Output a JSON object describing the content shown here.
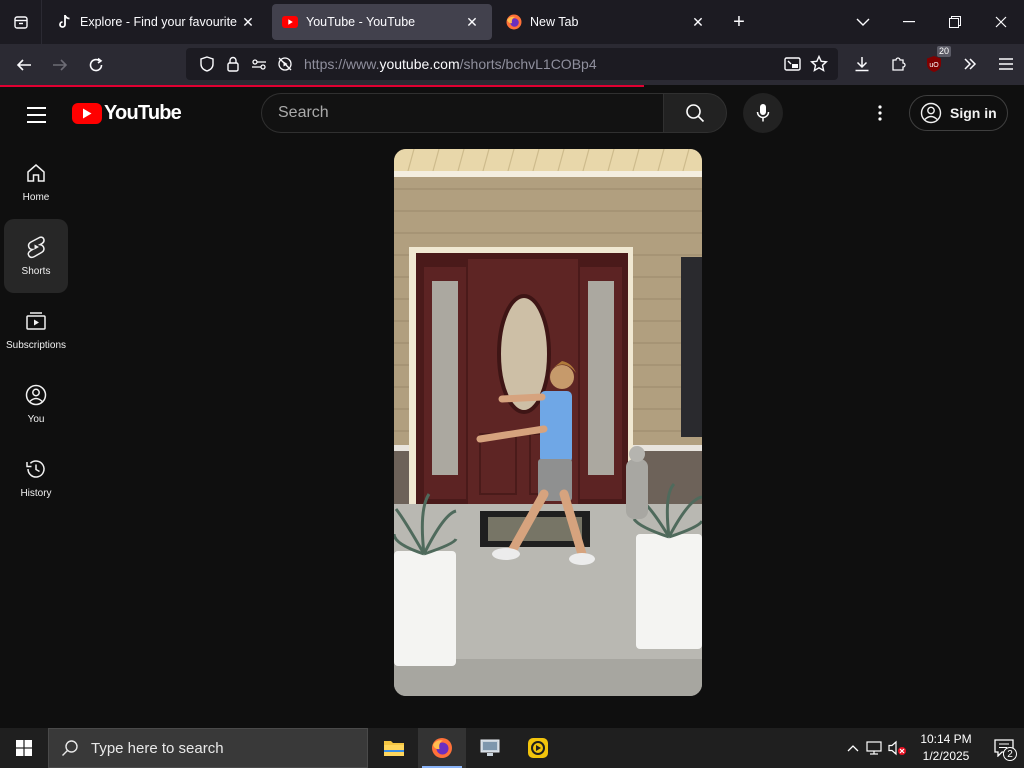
{
  "browser": {
    "tabs": [
      {
        "title": "Explore - Find your favourite vi",
        "favicon": "tiktok-icon",
        "active": false
      },
      {
        "title": "YouTube - YouTube",
        "favicon": "youtube-icon",
        "active": true
      },
      {
        "title": "New Tab",
        "favicon": "firefox-icon",
        "active": false
      }
    ],
    "url_prefix": "https://www.",
    "url_domain": "youtube.com",
    "url_path": "/shorts/bchvL1COBp4",
    "extension_badge": "20"
  },
  "youtube": {
    "logo_text": "YouTube",
    "search_placeholder": "Search",
    "sign_in_label": "Sign in",
    "guide": [
      {
        "label": "Home",
        "icon": "home-icon"
      },
      {
        "label": "Shorts",
        "icon": "shorts-icon",
        "active": true
      },
      {
        "label": "Subscriptions",
        "icon": "subscriptions-icon"
      },
      {
        "label": "You",
        "icon": "you-icon"
      },
      {
        "label": "History",
        "icon": "history-icon"
      }
    ]
  },
  "taskbar": {
    "search_placeholder": "Type here to search",
    "time": "10:14 PM",
    "date": "1/2/2025",
    "notification_count": "2"
  },
  "colors": {
    "youtube_red": "#ff0000",
    "background": "#0f0f0f",
    "firefox_toolbar": "#2b2a33",
    "firefox_tabstrip": "#1c1b22"
  }
}
